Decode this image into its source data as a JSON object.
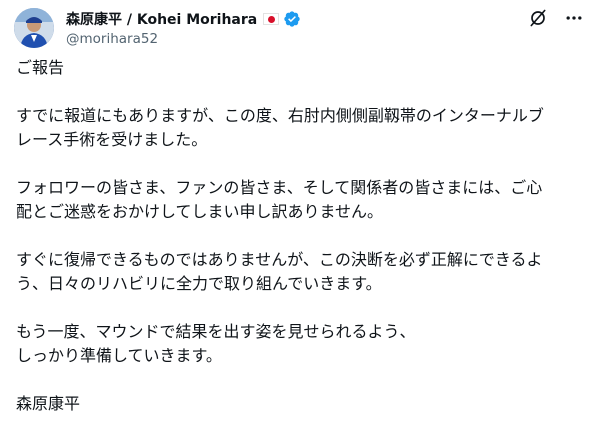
{
  "author": {
    "display_name": "森原康平 / Kohei Morihara",
    "handle": "@morihara52",
    "flag_icon": "japan-flag-icon",
    "verified_icon": "verified-badge-icon",
    "verified_color": "#1d9bf0"
  },
  "actions": {
    "grok_icon": "grok-icon",
    "more_icon": "more-icon"
  },
  "post": {
    "paragraphs": [
      "ご報告",
      "すでに報道にもありますが、この度、右肘内側側副靱帯のインターナルブ\nレース手術を受けました。",
      "フォロワーの皆さま、ファンの皆さま、そして関係者の皆さまには、ご心\n配とご迷惑をおかけしてしまい申し訳ありません。",
      "すぐに復帰できるものではありませんが、この決断を必ず正解にできるよ\nう、日々のリハビリに全力で取り組んでいきます。",
      "もう一度、マウンドで結果を出す姿を見せられるよう、\nしっかり準備していきます。",
      "森原康平"
    ]
  },
  "colors": {
    "text": "#0f1419",
    "secondary": "#536471",
    "accent": "#1d9bf0"
  }
}
